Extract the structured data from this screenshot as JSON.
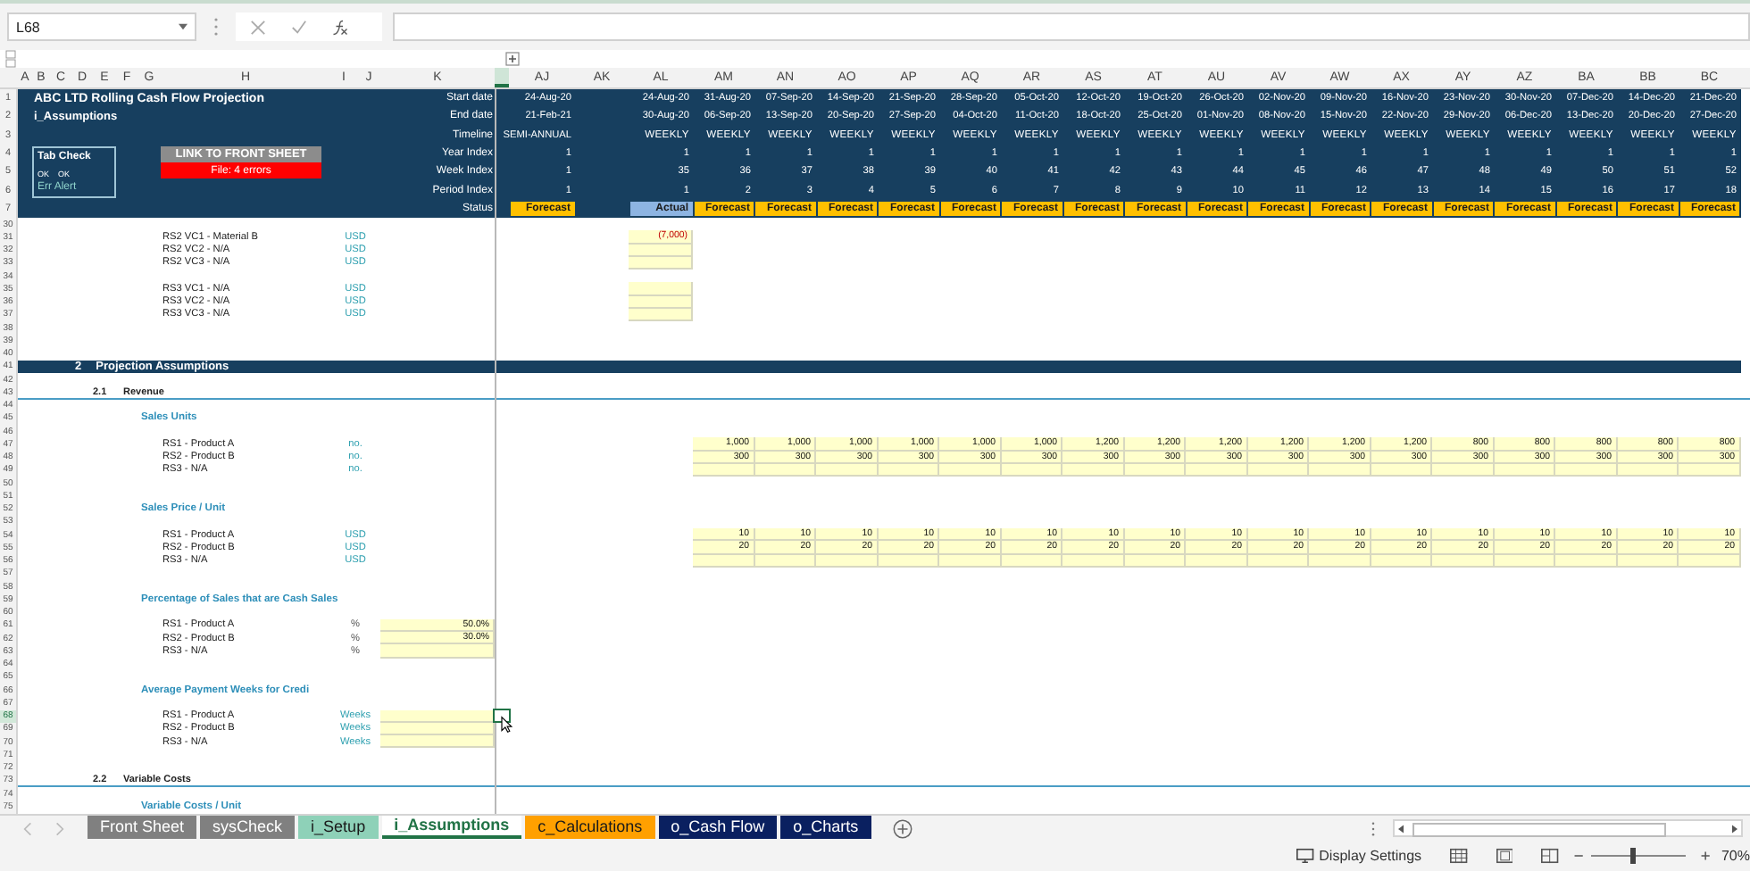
{
  "name_box": "L68",
  "column_headers": [
    "A",
    "B",
    "C",
    "D",
    "E",
    "F",
    "G",
    "H",
    "I",
    "J",
    "K",
    "AJ",
    "AK",
    "AL",
    "AM",
    "AN",
    "AO",
    "AP",
    "AQ",
    "AR",
    "AS",
    "AT",
    "AU",
    "AV",
    "AW",
    "AX",
    "AY",
    "AZ",
    "BA",
    "BB",
    "BC"
  ],
  "header": {
    "title": "ABC LTD Rolling Cash Flow Projection",
    "subtitle": "i_Assumptions",
    "tab_check": {
      "title": "Tab Check",
      "status_1": "OK",
      "status_2": "OK",
      "alert": "Err Alert"
    },
    "link_button": "LINK TO FRONT SHEET",
    "error_banner": "File: 4 errors",
    "row_numbers": [
      "1",
      "2",
      "3",
      "4",
      "5",
      "6",
      "7"
    ],
    "labels": [
      "Start date",
      "End date",
      "Timeline",
      "Year Index",
      "Week Index",
      "Period Index",
      "Status"
    ],
    "summary": {
      "start": "24-Aug-20",
      "end": "21-Feb-21",
      "timeline": "SEMI-ANNUAL",
      "year": "1",
      "week": "1",
      "period": "1",
      "status": "Forecast",
      "kind": "forecast"
    }
  },
  "periods": [
    {
      "start": "24-Aug-20",
      "end": "30-Aug-20",
      "timeline": "WEEKLY",
      "year": "1",
      "week": "35",
      "period": "1",
      "status": "Actual",
      "kind": "actual"
    },
    {
      "start": "31-Aug-20",
      "end": "06-Sep-20",
      "timeline": "WEEKLY",
      "year": "1",
      "week": "36",
      "period": "2",
      "status": "Forecast",
      "kind": "forecast"
    },
    {
      "start": "07-Sep-20",
      "end": "13-Sep-20",
      "timeline": "WEEKLY",
      "year": "1",
      "week": "37",
      "period": "3",
      "status": "Forecast",
      "kind": "forecast"
    },
    {
      "start": "14-Sep-20",
      "end": "20-Sep-20",
      "timeline": "WEEKLY",
      "year": "1",
      "week": "38",
      "period": "4",
      "status": "Forecast",
      "kind": "forecast"
    },
    {
      "start": "21-Sep-20",
      "end": "27-Sep-20",
      "timeline": "WEEKLY",
      "year": "1",
      "week": "39",
      "period": "5",
      "status": "Forecast",
      "kind": "forecast"
    },
    {
      "start": "28-Sep-20",
      "end": "04-Oct-20",
      "timeline": "WEEKLY",
      "year": "1",
      "week": "40",
      "period": "6",
      "status": "Forecast",
      "kind": "forecast"
    },
    {
      "start": "05-Oct-20",
      "end": "11-Oct-20",
      "timeline": "WEEKLY",
      "year": "1",
      "week": "41",
      "period": "7",
      "status": "Forecast",
      "kind": "forecast"
    },
    {
      "start": "12-Oct-20",
      "end": "18-Oct-20",
      "timeline": "WEEKLY",
      "year": "1",
      "week": "42",
      "period": "8",
      "status": "Forecast",
      "kind": "forecast"
    },
    {
      "start": "19-Oct-20",
      "end": "25-Oct-20",
      "timeline": "WEEKLY",
      "year": "1",
      "week": "43",
      "period": "9",
      "status": "Forecast",
      "kind": "forecast"
    },
    {
      "start": "26-Oct-20",
      "end": "01-Nov-20",
      "timeline": "WEEKLY",
      "year": "1",
      "week": "44",
      "period": "10",
      "status": "Forecast",
      "kind": "forecast"
    },
    {
      "start": "02-Nov-20",
      "end": "08-Nov-20",
      "timeline": "WEEKLY",
      "year": "1",
      "week": "45",
      "period": "11",
      "status": "Forecast",
      "kind": "forecast"
    },
    {
      "start": "09-Nov-20",
      "end": "15-Nov-20",
      "timeline": "WEEKLY",
      "year": "1",
      "week": "46",
      "period": "12",
      "status": "Forecast",
      "kind": "forecast"
    },
    {
      "start": "16-Nov-20",
      "end": "22-Nov-20",
      "timeline": "WEEKLY",
      "year": "1",
      "week": "47",
      "period": "13",
      "status": "Forecast",
      "kind": "forecast"
    },
    {
      "start": "23-Nov-20",
      "end": "29-Nov-20",
      "timeline": "WEEKLY",
      "year": "1",
      "week": "48",
      "period": "14",
      "status": "Forecast",
      "kind": "forecast"
    },
    {
      "start": "30-Nov-20",
      "end": "06-Dec-20",
      "timeline": "WEEKLY",
      "year": "1",
      "week": "49",
      "period": "15",
      "status": "Forecast",
      "kind": "forecast"
    },
    {
      "start": "07-Dec-20",
      "end": "13-Dec-20",
      "timeline": "WEEKLY",
      "year": "1",
      "week": "50",
      "period": "16",
      "status": "Forecast",
      "kind": "forecast"
    },
    {
      "start": "14-Dec-20",
      "end": "20-Dec-20",
      "timeline": "WEEKLY",
      "year": "1",
      "week": "51",
      "period": "17",
      "status": "Forecast",
      "kind": "forecast"
    },
    {
      "start": "21-Dec-20",
      "end": "27-Dec-20",
      "timeline": "WEEKLY",
      "year": "1",
      "week": "52",
      "period": "18",
      "status": "Forecast",
      "kind": "forecast"
    }
  ],
  "rows": [
    {
      "number": "30",
      "kind": "blank",
      "selected": false
    },
    {
      "number": "31",
      "kind": "item_al",
      "label": "RS2 VC1 - Material B",
      "unit": "USD",
      "values": [
        "(7,000)"
      ],
      "selected": false
    },
    {
      "number": "32",
      "kind": "item_al",
      "label": "RS2 VC2 - N/A",
      "unit": "USD",
      "selected": false
    },
    {
      "number": "33",
      "kind": "item_al",
      "label": "RS2 VC3 - N/A",
      "unit": "USD",
      "selected": false
    },
    {
      "number": "34",
      "kind": "blank",
      "selected": false
    },
    {
      "number": "35",
      "kind": "item_al",
      "label": "RS3 VC1 - N/A",
      "unit": "USD",
      "selected": false
    },
    {
      "number": "36",
      "kind": "item_al",
      "label": "RS3 VC2 - N/A",
      "unit": "USD",
      "selected": false
    },
    {
      "number": "37",
      "kind": "item_al",
      "label": "RS3 VC3 - N/A",
      "unit": "USD",
      "selected": false
    },
    {
      "number": "38",
      "kind": "blank",
      "selected": false
    },
    {
      "number": "39",
      "kind": "blank",
      "selected": false
    },
    {
      "number": "40",
      "kind": "blank",
      "selected": false
    },
    {
      "number": "41",
      "kind": "section",
      "index": "2",
      "title": "Projection Assumptions",
      "selected": false
    },
    {
      "number": "42",
      "kind": "blank",
      "selected": false
    },
    {
      "number": "43",
      "kind": "subsection",
      "index": "2.1",
      "title": "Revenue",
      "selected": false
    },
    {
      "number": "44",
      "kind": "blank",
      "selected": false
    },
    {
      "number": "45",
      "kind": "heading",
      "title": "Sales Units",
      "selected": false
    },
    {
      "number": "46",
      "kind": "blank",
      "selected": false
    },
    {
      "number": "47",
      "kind": "item_periods",
      "label": "RS1 - Product A",
      "unit": "no.",
      "values": [
        "1,000",
        "1,000",
        "1,000",
        "1,000",
        "1,000",
        "1,000",
        "1,200",
        "1,200",
        "1,200",
        "1,200",
        "1,200",
        "1,200",
        "800",
        "800",
        "800",
        "800",
        "800"
      ],
      "selected": false
    },
    {
      "number": "48",
      "kind": "item_periods",
      "label": "RS2 - Product B",
      "unit": "no.",
      "values": [
        "300",
        "300",
        "300",
        "300",
        "300",
        "300",
        "300",
        "300",
        "300",
        "300",
        "300",
        "300",
        "300",
        "300",
        "300",
        "300",
        "300"
      ],
      "selected": false
    },
    {
      "number": "49",
      "kind": "item_periods",
      "label": "RS3 - N/A",
      "unit": "no.",
      "selected": false
    },
    {
      "number": "50",
      "kind": "blank",
      "selected": false
    },
    {
      "number": "51",
      "kind": "blank",
      "selected": false
    },
    {
      "number": "52",
      "kind": "heading",
      "title": "Sales Price / Unit",
      "selected": false
    },
    {
      "number": "53",
      "kind": "blank",
      "selected": false
    },
    {
      "number": "54",
      "kind": "item_periods",
      "label": "RS1 - Product A",
      "unit": "USD",
      "values": [
        "10",
        "10",
        "10",
        "10",
        "10",
        "10",
        "10",
        "10",
        "10",
        "10",
        "10",
        "10",
        "10",
        "10",
        "10",
        "10",
        "10"
      ],
      "selected": false
    },
    {
      "number": "55",
      "kind": "item_periods",
      "label": "RS2 - Product B",
      "unit": "USD",
      "values": [
        "20",
        "20",
        "20",
        "20",
        "20",
        "20",
        "20",
        "20",
        "20",
        "20",
        "20",
        "20",
        "20",
        "20",
        "20",
        "20",
        "20"
      ],
      "selected": false
    },
    {
      "number": "56",
      "kind": "item_periods",
      "label": "RS3 - N/A",
      "unit": "USD",
      "selected": false
    },
    {
      "number": "57",
      "kind": "blank",
      "selected": false
    },
    {
      "number": "58",
      "kind": "blank",
      "selected": false
    },
    {
      "number": "59",
      "kind": "heading",
      "title": "Percentage of Sales that are Cash Sales",
      "selected": false
    },
    {
      "number": "60",
      "kind": "blank",
      "selected": false
    },
    {
      "number": "61",
      "kind": "item_k",
      "label": "RS1 - Product A",
      "unit": "%",
      "values": [
        "50.0%"
      ],
      "selected": false
    },
    {
      "number": "62",
      "kind": "item_k",
      "label": "RS2 - Product B",
      "unit": "%",
      "values": [
        "30.0%"
      ],
      "selected": false
    },
    {
      "number": "63",
      "kind": "item_k",
      "label": "RS3 - N/A",
      "unit": "%",
      "selected": false
    },
    {
      "number": "64",
      "kind": "blank",
      "selected": false
    },
    {
      "number": "65",
      "kind": "blank",
      "selected": false
    },
    {
      "number": "66",
      "kind": "heading",
      "title": "Average Payment Weeks for Credi",
      "selected": false
    },
    {
      "number": "67",
      "kind": "blank",
      "selected": false
    },
    {
      "number": "68",
      "kind": "item_k",
      "label": "RS1 - Product A",
      "unit": "Weeks",
      "selected": true
    },
    {
      "number": "69",
      "kind": "item_k",
      "label": "RS2 - Product B",
      "unit": "Weeks",
      "selected": false
    },
    {
      "number": "70",
      "kind": "item_k",
      "label": "RS3 - N/A",
      "unit": "Weeks",
      "selected": false
    },
    {
      "number": "71",
      "kind": "blank",
      "selected": false
    },
    {
      "number": "72",
      "kind": "blank",
      "selected": false
    },
    {
      "number": "73",
      "kind": "subsection",
      "index": "2.2",
      "title": "Variable Costs",
      "selected": false
    },
    {
      "number": "74",
      "kind": "blank",
      "selected": false
    },
    {
      "number": "75",
      "kind": "heading",
      "title": "Variable Costs / Unit",
      "selected": false
    }
  ],
  "sheet_tabs": [
    {
      "label": "Front Sheet",
      "color": "#808080",
      "selected": false
    },
    {
      "label": "sysCheck",
      "color": "#808080",
      "selected": false
    },
    {
      "label": "i_Setup",
      "color": "#8ed1b8",
      "selected": false
    },
    {
      "label": "i_Assumptions",
      "color": "#217346",
      "selected": true
    },
    {
      "label": "c_Calculations",
      "color": "#ffa000",
      "selected": false
    },
    {
      "label": "o_Cash Flow",
      "color": "#0a2060",
      "selected": false
    },
    {
      "label": "o_Charts",
      "color": "#0a2060",
      "selected": false
    }
  ],
  "status_bar": {
    "display_settings": "Display Settings",
    "zoom": {
      "level": 0.45,
      "reading": "70%"
    }
  }
}
